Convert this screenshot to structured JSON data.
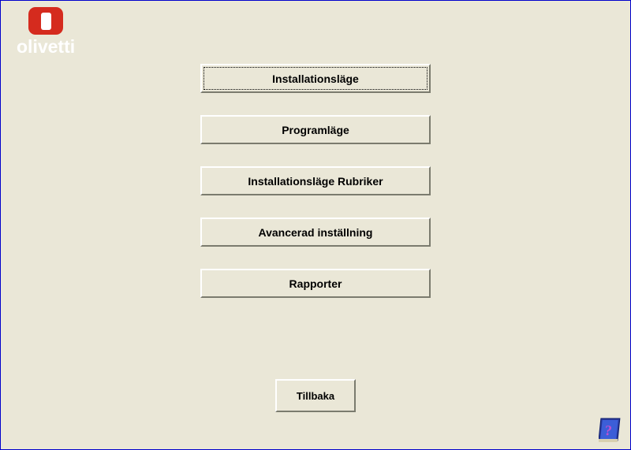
{
  "brand": {
    "name": "olivetti"
  },
  "menu": {
    "items": [
      {
        "label": "Installationsläge",
        "focused": true
      },
      {
        "label": "Programläge",
        "focused": false
      },
      {
        "label": "Installationsläge Rubriker",
        "focused": false
      },
      {
        "label": "Avancerad inställning",
        "focused": false
      },
      {
        "label": "Rapporter",
        "focused": false
      }
    ]
  },
  "back_button": {
    "label": "Tillbaka"
  },
  "icons": {
    "help": "help-icon"
  }
}
